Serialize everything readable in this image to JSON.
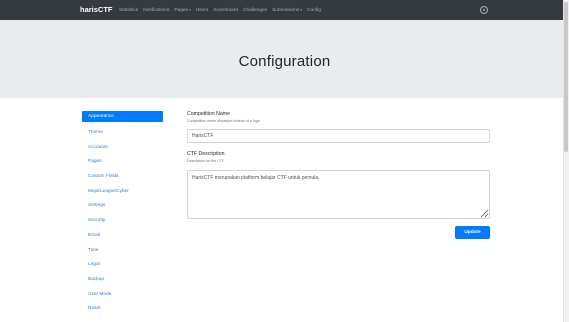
{
  "navbar": {
    "brand": "harisCTF",
    "links": [
      {
        "label": "Statistics"
      },
      {
        "label": "Notifications"
      },
      {
        "label": "Pages",
        "caret": "▾"
      },
      {
        "label": "Users"
      },
      {
        "label": "Scoreboard"
      },
      {
        "label": "Challenges"
      },
      {
        "label": "Submissions",
        "caret": "▾"
      },
      {
        "label": "Config"
      }
    ],
    "theme_icon": "half-circle-theme-icon"
  },
  "header": {
    "title": "Configuration"
  },
  "sidebar": {
    "items": [
      {
        "label": "Appearance",
        "active": true
      },
      {
        "label": "Theme"
      },
      {
        "label": "Accounts"
      },
      {
        "label": "Pages"
      },
      {
        "label": "Custom Fields"
      },
      {
        "label": "MajorLeagueCyber"
      },
      {
        "label": "Settings"
      },
      {
        "label": "Security"
      },
      {
        "label": "Email"
      },
      {
        "label": "Time"
      },
      {
        "label": "Legal"
      },
      {
        "label": "Backup"
      },
      {
        "label": "User Mode"
      },
      {
        "label": "Reset"
      }
    ]
  },
  "form": {
    "name_label": "Competition Name",
    "name_help": "Competition name displayed instead of a logo",
    "name_value": "HarisCTF",
    "desc_label": "CTF Description",
    "desc_help": "Description for the CTF",
    "desc_value": "HarisCTF merupakan platform belajar CTF untuk pemula.",
    "update_label": "Update"
  },
  "colors": {
    "navbar_bg": "#343a40",
    "jumbotron_bg": "#e9ecef",
    "primary": "#007bff",
    "link": "#3d7dc4"
  }
}
